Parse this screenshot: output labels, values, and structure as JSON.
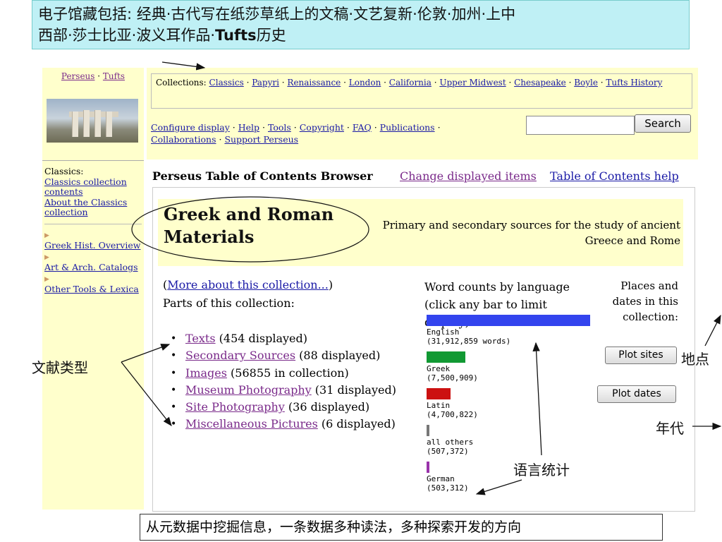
{
  "annotation_top": {
    "text_a": "电子馆藏包括: 经典·古代写在纸莎草纸上的文稿·文艺复新·伦敦·加州·上中",
    "text_b": "西部·莎士比亚·波义耳作品·",
    "text_bold": "Tufts",
    "text_c": "历史"
  },
  "left": {
    "links": {
      "perseus": "Perseus",
      "sep": " · ",
      "tufts": "Tufts"
    },
    "classics_label": "Classics:",
    "classics_contents": "Classics collection contents",
    "about": "About the Classics collection",
    "greek_hist": "Greek Hist. Overview",
    "art_arch": "Art & Arch. Catalogs",
    "other_tools": "Other Tools & Lexica"
  },
  "header": {
    "collections_label": "Collections:",
    "collections": [
      "Classics",
      "Papyri",
      "Renaissance",
      "London",
      "California",
      "Upper Midwest",
      "Chesapeake",
      "Boyle",
      "Tufts History"
    ],
    "cfg_links": [
      "Configure display",
      "Help",
      "Tools",
      "Copyright",
      "FAQ",
      "Publications",
      "Collaborations",
      "Support Perseus"
    ],
    "search_button": "Search",
    "search_value": ""
  },
  "browser": {
    "title": "Perseus Table of Contents Browser",
    "change_items": "Change displayed items",
    "toc_help": "Table of Contents help"
  },
  "collection": {
    "title_l1": "Greek and Roman",
    "title_l2": "Materials",
    "desc": "Primary and secondary sources for the study of ancient Greece and Rome",
    "more_open": "(",
    "more": "More about this collection...",
    "more_close": ")",
    "parts_label": "Parts of this collection:",
    "parts": [
      {
        "name": "Texts",
        "count": " (454 displayed)"
      },
      {
        "name": "Secondary Sources",
        "count": " (88 displayed)"
      },
      {
        "name": "Images",
        "count": " (56855 in collection)"
      },
      {
        "name": "Museum Photography",
        "count": " (31 displayed)"
      },
      {
        "name": "Site Photography",
        "count": " (36 displayed)"
      },
      {
        "name": "Miscellaneous Pictures",
        "count": " (6 displayed)"
      }
    ]
  },
  "wordcounts": {
    "head_l1": "Word counts by language",
    "head_l2": "(click any bar to limit display):",
    "bars": [
      {
        "lang": "English",
        "count": "(31,912,859 words)",
        "value": 31912859,
        "color": "#3344ee"
      },
      {
        "lang": "Greek",
        "count": "(7,500,909)",
        "value": 7500909,
        "color": "#119933"
      },
      {
        "lang": "Latin",
        "count": "(4,700,822)",
        "value": 4700822,
        "color": "#cc1111"
      },
      {
        "lang": "all others",
        "count": "(507,372)",
        "value": 507372,
        "color": "#777777"
      },
      {
        "lang": "German",
        "count": "(503,312)",
        "value": 503312,
        "color": "#9933aa"
      }
    ]
  },
  "places": {
    "l1": "Places and",
    "l2": "dates in this",
    "l3": "collection:",
    "plot_sites": "Plot sites",
    "plot_dates": "Plot dates"
  },
  "annotations": {
    "doc_types": "文献类型",
    "place": "地点",
    "era": "年代",
    "lang_stats": "语言统计",
    "bottom": "从元数据中挖掘信息，一条数据多种读法，多种探索开发的方向"
  }
}
